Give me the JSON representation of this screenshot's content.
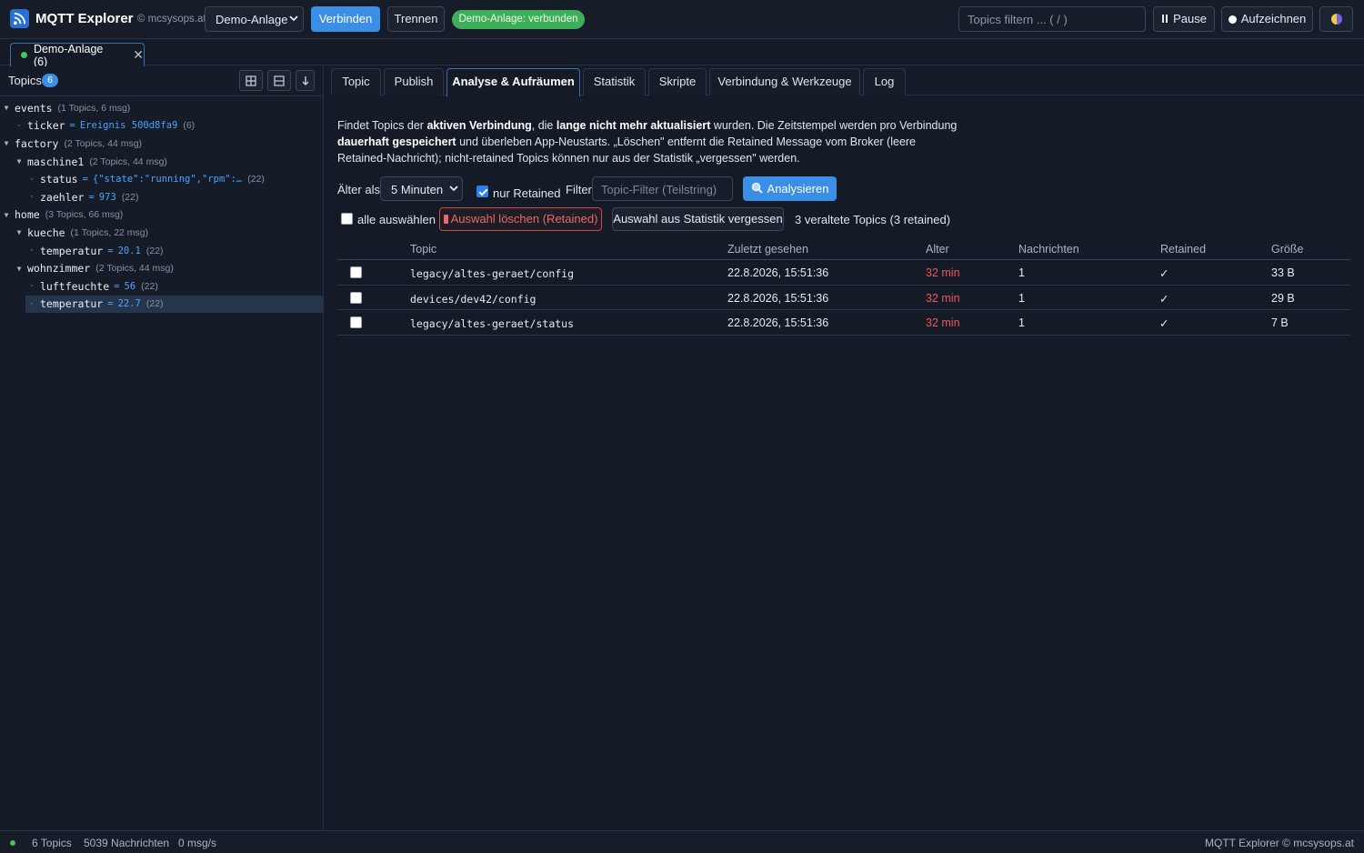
{
  "app": {
    "title": "MQTT Explorer",
    "copyright": "© mcsysops.at",
    "connection_select": "Demo-Anlage",
    "connect_label": "Verbinden",
    "disconnect_label": "Trennen",
    "status_pill": "Demo-Anlage: verbunden",
    "filter_placeholder": "Topics filtern ... ( / )",
    "pause_label": "Pause",
    "record_label": "Aufzeichnen"
  },
  "connection_tab": {
    "label": "Demo-Anlage (6)"
  },
  "sidebar": {
    "title": "Topics",
    "count": "6",
    "tree": [
      {
        "name": "events",
        "meta": "(1 Topics, 6 msg)"
      },
      {
        "name": "ticker",
        "value": "Ereignis 500d8fa9",
        "meta": "(6)"
      },
      {
        "name": "factory",
        "meta": "(2 Topics, 44 msg)"
      },
      {
        "name": "maschine1",
        "meta": "(2 Topics, 44 msg)"
      },
      {
        "name": "status",
        "value": "{\"state\":\"running\",\"rpm\":…",
        "meta": "(22)"
      },
      {
        "name": "zaehler",
        "value": "973",
        "meta": "(22)"
      },
      {
        "name": "home",
        "meta": "(3 Topics, 66 msg)"
      },
      {
        "name": "kueche",
        "meta": "(1 Topics, 22 msg)"
      },
      {
        "name": "temperatur",
        "value": "20.1",
        "meta": "(22)"
      },
      {
        "name": "wohnzimmer",
        "meta": "(2 Topics, 44 msg)"
      },
      {
        "name": "luftfeuchte",
        "value": "56",
        "meta": "(22)"
      },
      {
        "name": "temperatur",
        "value": "22.7",
        "meta": "(22)"
      }
    ]
  },
  "tabs": [
    "Topic",
    "Publish",
    "Analyse & Aufräumen",
    "Statistik",
    "Skripte",
    "Verbindung & Werkzeuge",
    "Log"
  ],
  "analysis": {
    "desc": {
      "p1": "Findet Topics der ",
      "b1": "aktiven Verbindung",
      "p2": ", die ",
      "b2": "lange nicht mehr aktualisiert",
      "p3": " wurden. Die Zeitstempel werden pro Verbindung ",
      "b3": "dauerhaft gespeichert",
      "p4": " und überleben App-Neustarts. „Löschen\" entfernt die Retained Message vom Broker (leere Retained-Nachricht); nicht-retained Topics können nur aus der Statistik „vergessen\" werden."
    },
    "older_than_label": "Älter als",
    "older_than_value": "5 Minuten",
    "only_retained_label": "nur Retained",
    "filter_label": "Filter",
    "filter_placeholder": "Topic-Filter (Teilstring)",
    "analyse_label": "Analysieren",
    "select_all_label": "alle auswählen",
    "delete_label": "Auswahl löschen (Retained)",
    "forget_label": "Auswahl aus Statistik vergessen",
    "summary": "3 veraltete Topics (3 retained)",
    "columns": [
      "Topic",
      "Zuletzt gesehen",
      "Alter",
      "Nachrichten",
      "Retained",
      "Größe"
    ],
    "rows": [
      {
        "topic": "legacy/altes-geraet/config",
        "last_seen": "22.8.2026, 15:51:36",
        "age": "32 min",
        "messages": "1",
        "retained": "✓",
        "size": "33 B"
      },
      {
        "topic": "devices/dev42/config",
        "last_seen": "22.8.2026, 15:51:36",
        "age": "32 min",
        "messages": "1",
        "retained": "✓",
        "size": "29 B"
      },
      {
        "topic": "legacy/altes-geraet/status",
        "last_seen": "22.8.2026, 15:51:36",
        "age": "32 min",
        "messages": "1",
        "retained": "✓",
        "size": "7 B"
      }
    ]
  },
  "statusbar": {
    "topics": "6 Topics",
    "messages": "5039 Nachrichten",
    "rate": "0 msg/s",
    "right": "MQTT Explorer © mcsysops.at"
  }
}
